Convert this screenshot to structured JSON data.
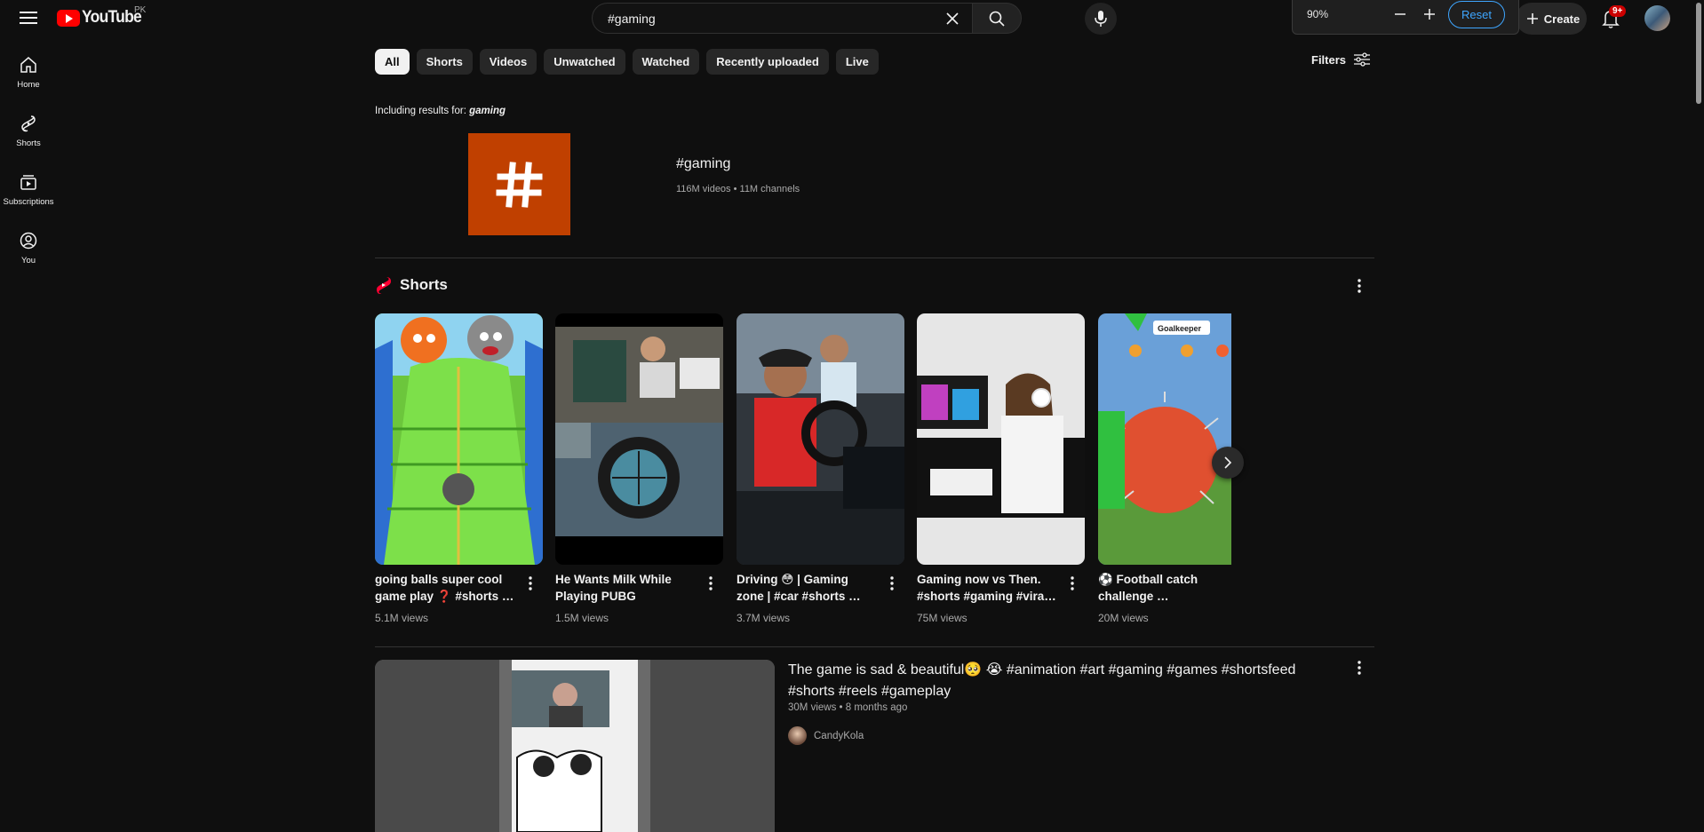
{
  "header": {
    "logo_text": "YouTube",
    "country_code": "PK",
    "search_value": "#gaming",
    "create_label": "Create",
    "notification_count": "9+"
  },
  "zoom": {
    "level": "90%",
    "reset_label": "Reset"
  },
  "sidebar": {
    "items": [
      {
        "label": "Home",
        "icon": "home-icon"
      },
      {
        "label": "Shorts",
        "icon": "shorts-icon"
      },
      {
        "label": "Subscriptions",
        "icon": "subscriptions-icon"
      },
      {
        "label": "You",
        "icon": "you-icon"
      }
    ]
  },
  "chips": [
    "All",
    "Shorts",
    "Videos",
    "Unwatched",
    "Watched",
    "Recently uploaded",
    "Live"
  ],
  "filters_label": "Filters",
  "including": {
    "prefix": "Including results for:",
    "term": "gaming"
  },
  "hashtag": {
    "title": "#gaming",
    "meta": "116M videos • 11M channels"
  },
  "shorts_shelf": {
    "title": "Shorts",
    "items": [
      {
        "title": "going balls super cool game play ❓ #shorts …",
        "views": "5.1M views"
      },
      {
        "title": "He Wants Milk While Playing PUBG MOBİLE…",
        "views": "1.5M views"
      },
      {
        "title": "Driving 😳 | Gaming zone | #car #shorts …",
        "views": "3.7M views"
      },
      {
        "title": "Gaming now vs Then. #shorts #gaming #vira…",
        "views": "75M views"
      },
      {
        "title": "⚽ Football catch challenge …",
        "views": "20M views"
      }
    ],
    "goalkeeper_badge": "Goalkeeper"
  },
  "video": {
    "title": "The game is sad & beautiful🥺 😭  #animation #art #gaming #games #shortsfeed #shorts #reels #gameplay",
    "meta": "30M views • 8 months ago",
    "channel": "CandyKola"
  },
  "colors": {
    "accent": "#3ea6ff",
    "brand": "#ff0000",
    "hashtag_tile": "#c04000"
  }
}
